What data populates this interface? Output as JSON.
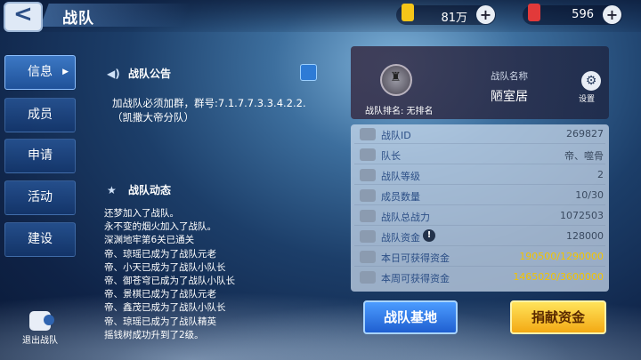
{
  "header": {
    "title": "战队",
    "back_glyph": "<"
  },
  "currencies": [
    {
      "icon": "gold-coin-icon",
      "value": "81万",
      "color": "#f5c518"
    },
    {
      "icon": "red-gem-icon",
      "value": "596",
      "color": "#e23a3a"
    }
  ],
  "nav": {
    "items": [
      {
        "label": "信息",
        "active": true
      },
      {
        "label": "成员"
      },
      {
        "label": "申请"
      },
      {
        "label": "活动"
      },
      {
        "label": "建设"
      }
    ],
    "exit_label": "退出战队"
  },
  "announcement": {
    "title": "战队公告",
    "text": "加战队必须加群，群号:7.1.7.7.3.3.4.2.2.（凯撒大帝分队）"
  },
  "activity": {
    "title": "战队动态",
    "lines": [
      "还梦加入了战队。",
      "永不变的烟火加入了战队。",
      "深渊地牢第6关已通关",
      "帝、琼瑶已成为了战队元老",
      "帝、小天已成为了战队小队长",
      "帝、御苍穹已成为了战队小队长",
      "帝、景棋已成为了战队元老",
      "帝、鑫茂已成为了战队小队长",
      "帝、琼瑶已成为了战队精英",
      "摇钱树成功升到了2级。"
    ]
  },
  "team": {
    "rank_text": "战队排名: 无排名",
    "name_label": "战队名称",
    "name": "陋室居",
    "settings_label": "设置",
    "stats": [
      {
        "label": "战队ID",
        "value": "269827",
        "icon": "id-card-icon"
      },
      {
        "label": "队长",
        "value": "帝、噬骨",
        "icon": "flag-icon"
      },
      {
        "label": "战队等级",
        "value": "2",
        "icon": "level-icon"
      },
      {
        "label": "成员数量",
        "value": "10/30",
        "icon": "members-icon"
      },
      {
        "label": "战队总战力",
        "value": "1072503",
        "icon": "power-icon"
      },
      {
        "label": "战队资金",
        "value": "128000",
        "icon": "coins-icon"
      },
      {
        "label": "本日可获得资金",
        "value": "190500/1290000",
        "icon": "coins-icon",
        "gold": true
      },
      {
        "label": "本周可获得资金",
        "value": "1465020/3600000",
        "icon": "coins-icon",
        "gold": true
      }
    ]
  },
  "buttons": {
    "base": "战队基地",
    "donate": "捐献资金"
  }
}
